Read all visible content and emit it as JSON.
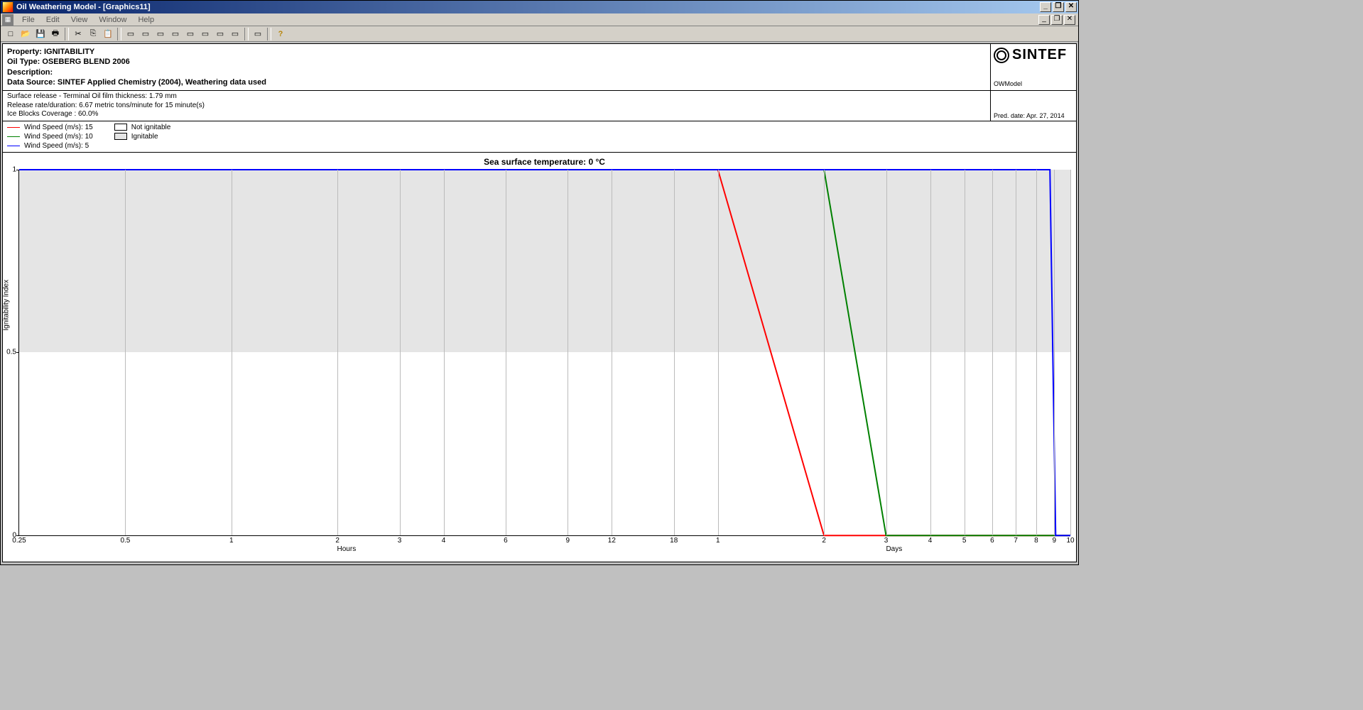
{
  "window": {
    "title": "Oil Weathering Model - [Graphics11]"
  },
  "menu": {
    "items": [
      "File",
      "Edit",
      "View",
      "Window",
      "Help"
    ]
  },
  "toolbar": {
    "new": "□",
    "open": "📂",
    "save": "💾",
    "print": "🖶",
    "cut": "✂",
    "copy": "⎘",
    "paste": "📋",
    "t1": "▭",
    "t2": "▭",
    "t3": "▭",
    "t4": "▭",
    "t5": "▭",
    "t6": "▭",
    "t7": "▭",
    "t8": "▭",
    "t9": "▭",
    "help": "?"
  },
  "info": {
    "property_label": "Property: ",
    "property_value": "IGNITABILITY",
    "oiltype_label": "Oil Type: ",
    "oiltype_value": "OSEBERG BLEND 2006",
    "description_label": "Description:",
    "datasource_label": "Data Source: ",
    "datasource_value": "SINTEF Applied Chemistry (2004), Weathering data used",
    "brand": "SINTEF",
    "owmodel": "OWModel",
    "release1": "Surface release - Terminal Oil film thickness: 1.79 mm",
    "release2": "Release rate/duration: 6.67 metric tons/minute for 15 minute(s)",
    "release3": "Ice Blocks Coverage : 60.0%",
    "pred_date": "Pred. date: Apr. 27, 2014"
  },
  "legend": {
    "series": [
      {
        "label": "Wind Speed (m/s): 15",
        "color": "#ff0000"
      },
      {
        "label": "Wind Speed (m/s): 10",
        "color": "#008000"
      },
      {
        "label": "Wind Speed (m/s): 5",
        "color": "#0000ff"
      }
    ],
    "regions": [
      {
        "label": "Not ignitable",
        "fill": "#ffffff"
      },
      {
        "label": "Ignitable",
        "fill": "#e5e5e5"
      }
    ]
  },
  "chart_data": {
    "type": "line",
    "title": "Sea surface temperature: 0 °C",
    "xlabel_left": "Hours",
    "xlabel_right": "Days",
    "ylabel": "Ignitability Index",
    "x_log": true,
    "x_ticks_hours": [
      0.25,
      0.5,
      1,
      2,
      3,
      4,
      6,
      9,
      12,
      18,
      24,
      48,
      72,
      96,
      120,
      144,
      168,
      192,
      216,
      240
    ],
    "x_tick_labels": [
      "0.25",
      "0.5",
      "1",
      "2",
      "3",
      "4",
      "6",
      "9",
      "12",
      "18",
      "1",
      "2",
      "3",
      "4",
      "5",
      "6",
      "7",
      "8",
      "9",
      "10"
    ],
    "xlim_hours": [
      0.25,
      240
    ],
    "ylim": [
      0,
      1
    ],
    "y_ticks": [
      0,
      0.5,
      1
    ],
    "regions": [
      {
        "name": "Ignitable",
        "y0": 0.5,
        "y1": 1.0,
        "fill": "#e5e5e5"
      },
      {
        "name": "Not ignitable",
        "y0": 0.0,
        "y1": 0.5,
        "fill": "#ffffff"
      }
    ],
    "series": [
      {
        "name": "Wind Speed (m/s): 15",
        "color": "#ff0000",
        "points": [
          [
            0.25,
            1
          ],
          [
            24,
            1
          ],
          [
            48,
            0
          ],
          [
            240,
            0
          ]
        ]
      },
      {
        "name": "Wind Speed (m/s): 10",
        "color": "#008000",
        "points": [
          [
            0.25,
            1
          ],
          [
            48,
            1
          ],
          [
            72,
            0
          ],
          [
            240,
            0
          ]
        ]
      },
      {
        "name": "Wind Speed (m/s): 5",
        "color": "#0000ff",
        "points": [
          [
            0.25,
            1
          ],
          [
            210,
            1
          ],
          [
            218,
            0
          ],
          [
            240,
            0
          ]
        ]
      }
    ]
  }
}
